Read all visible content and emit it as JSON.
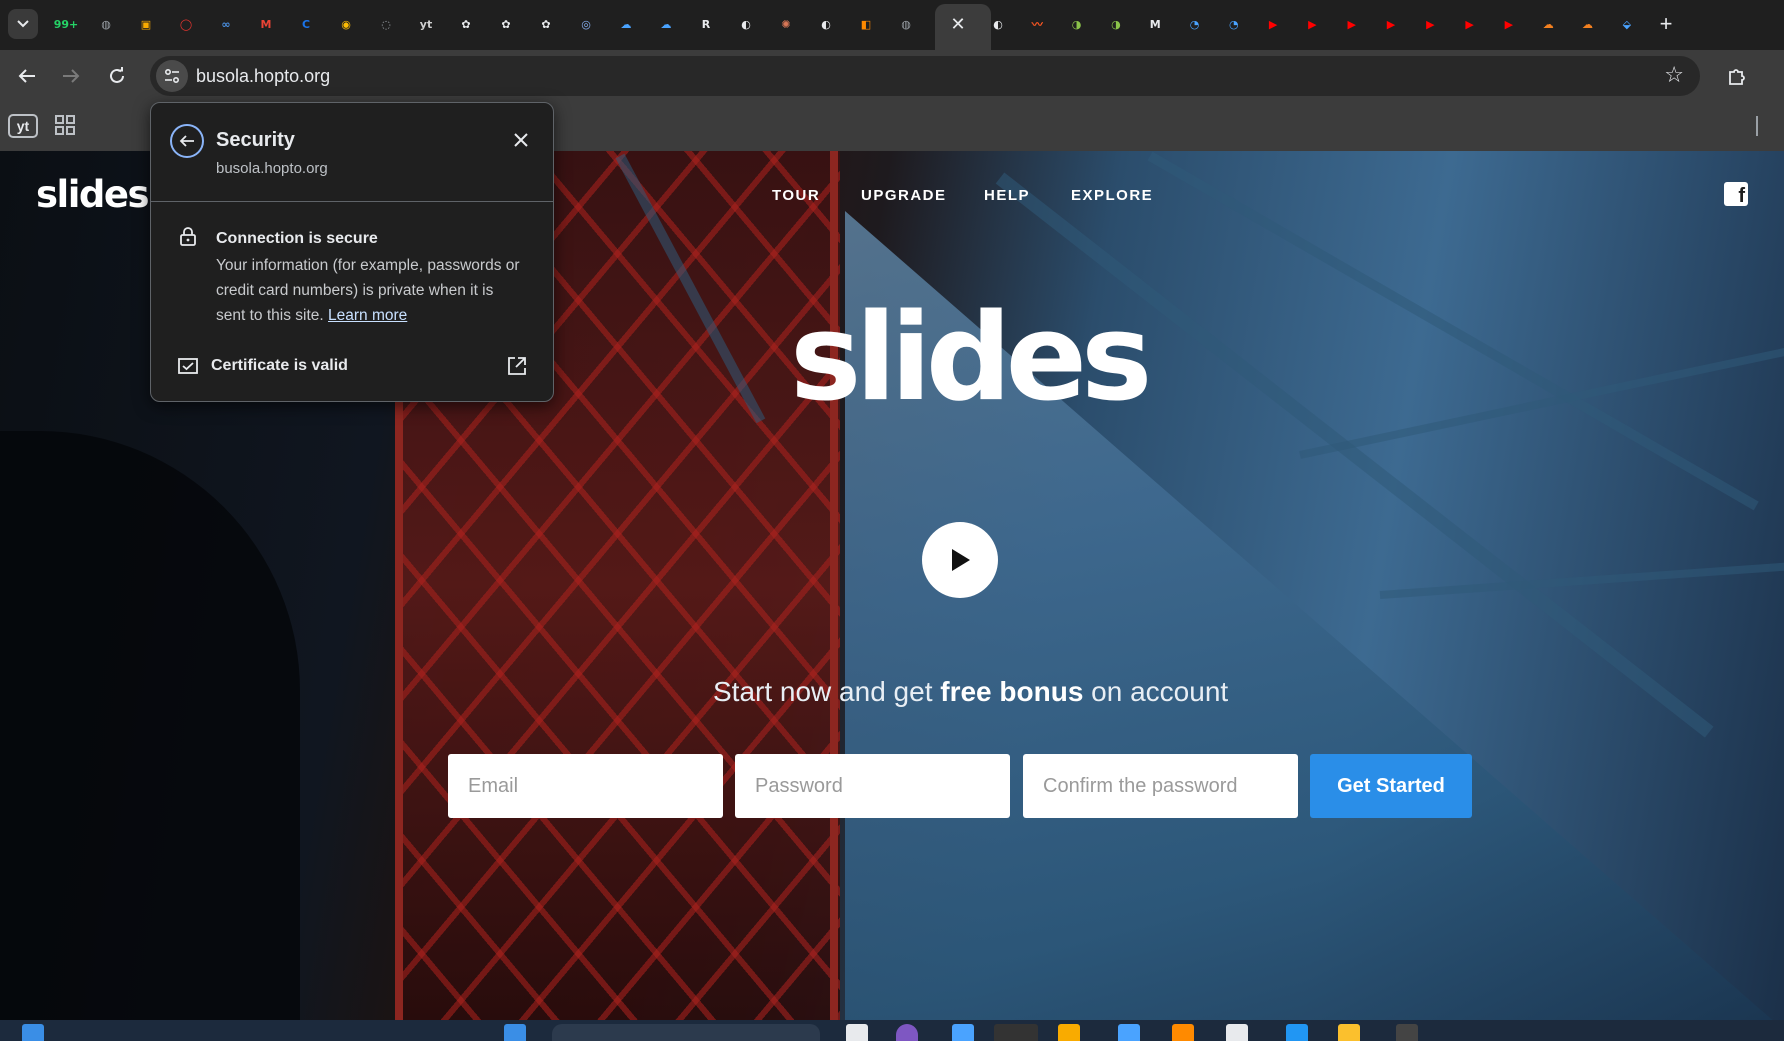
{
  "browser": {
    "url": "busola.hopto.org",
    "favicons": [
      {
        "name": "whatsapp-icon",
        "text": "99+",
        "color": "#25d366"
      },
      {
        "name": "globe-icon",
        "text": "◍",
        "color": "#9aa0a6"
      },
      {
        "name": "google-meet-icon",
        "text": "▣",
        "color": "#f9ab00"
      },
      {
        "name": "opera-icon",
        "text": "◯",
        "color": "#e3342f"
      },
      {
        "name": "meta-icon",
        "text": "∞",
        "color": "#4a90e2"
      },
      {
        "name": "gmail-icon",
        "text": "M",
        "color": "#ea4335"
      },
      {
        "name": "c-icon",
        "text": "C",
        "color": "#1a73e8"
      },
      {
        "name": "chrome-icon",
        "text": "◉",
        "color": "#fbbc04"
      },
      {
        "name": "loading-icon",
        "text": "◌",
        "color": "#9aa0a6"
      },
      {
        "name": "yt-icon",
        "text": "yt",
        "color": "#cfcfcf"
      },
      {
        "name": "openai-icon",
        "text": "✿",
        "color": "#e8eaed"
      },
      {
        "name": "openai-icon",
        "text": "✿",
        "color": "#e8eaed"
      },
      {
        "name": "openai-icon",
        "text": "✿",
        "color": "#e8eaed"
      },
      {
        "name": "app-icon",
        "text": "◎",
        "color": "#8ab4f8"
      },
      {
        "name": "cloud-icon",
        "text": "☁",
        "color": "#4aa3ff"
      },
      {
        "name": "onedrive-icon",
        "text": "☁",
        "color": "#4aa3ff"
      },
      {
        "name": "r-icon",
        "text": "R",
        "color": "#e8eaed"
      },
      {
        "name": "github-icon",
        "text": "◐",
        "color": "#e8eaed"
      },
      {
        "name": "claude-icon",
        "text": "✺",
        "color": "#d97757"
      },
      {
        "name": "github-icon",
        "text": "◐",
        "color": "#e8eaed"
      },
      {
        "name": "orange-app-icon",
        "text": "◧",
        "color": "#ff8a00"
      },
      {
        "name": "globe-icon",
        "text": "◍",
        "color": "#9aa0a6"
      }
    ],
    "favicons_right": [
      {
        "name": "github-icon",
        "text": "◐",
        "color": "#e8eaed"
      },
      {
        "name": "orange-chart-icon",
        "text": "〰",
        "color": "#ff5722"
      },
      {
        "name": "green-app-icon",
        "text": "◑",
        "color": "#8bc34a"
      },
      {
        "name": "green-app-icon",
        "text": "◑",
        "color": "#8bc34a"
      },
      {
        "name": "medium-icon",
        "text": "M",
        "color": "#e8eaed"
      },
      {
        "name": "circle-app-icon",
        "text": "◔",
        "color": "#4aa3ff"
      },
      {
        "name": "circle-app-icon",
        "text": "◔",
        "color": "#4aa3ff"
      },
      {
        "name": "youtube-icon",
        "text": "▶",
        "color": "#ff0000"
      },
      {
        "name": "youtube-icon",
        "text": "▶",
        "color": "#ff0000"
      },
      {
        "name": "youtube-icon",
        "text": "▶",
        "color": "#ff0000"
      },
      {
        "name": "youtube-icon",
        "text": "▶",
        "color": "#ff0000"
      },
      {
        "name": "youtube-icon",
        "text": "▶",
        "color": "#ff0000"
      },
      {
        "name": "youtube-icon",
        "text": "▶",
        "color": "#ff0000"
      },
      {
        "name": "youtube-icon",
        "text": "▶",
        "color": "#ff0000"
      },
      {
        "name": "cloudflare-icon",
        "text": "☁",
        "color": "#f38020"
      },
      {
        "name": "cloudflare-icon",
        "text": "☁",
        "color": "#f38020"
      },
      {
        "name": "location-icon",
        "text": "⬙",
        "color": "#4aa3ff"
      }
    ],
    "new_tab": "+",
    "close_tab": "✕",
    "bookmark_yt": "yt"
  },
  "popup": {
    "title": "Security",
    "host": "busola.hopto.org",
    "connection_title": "Connection is secure",
    "connection_desc": "Your information (for example, passwords or credit card numbers) is private when it is sent to this site.",
    "learn_more": "Learn more",
    "certificate": "Certificate is valid"
  },
  "site": {
    "logo": "slides",
    "nav": [
      "TOUR",
      "UPGRADE",
      "HELP",
      "EXPLORE"
    ],
    "hero_logo": "slides",
    "tagline_pre": "Start now and get ",
    "tagline_bold": "free bonus",
    "tagline_post": " on account",
    "email_placeholder": "Email",
    "password_placeholder": "Password",
    "confirm_placeholder": "Confirm the password",
    "cta": "Get Started",
    "colors": {
      "cta": "#2a8ee8"
    }
  }
}
